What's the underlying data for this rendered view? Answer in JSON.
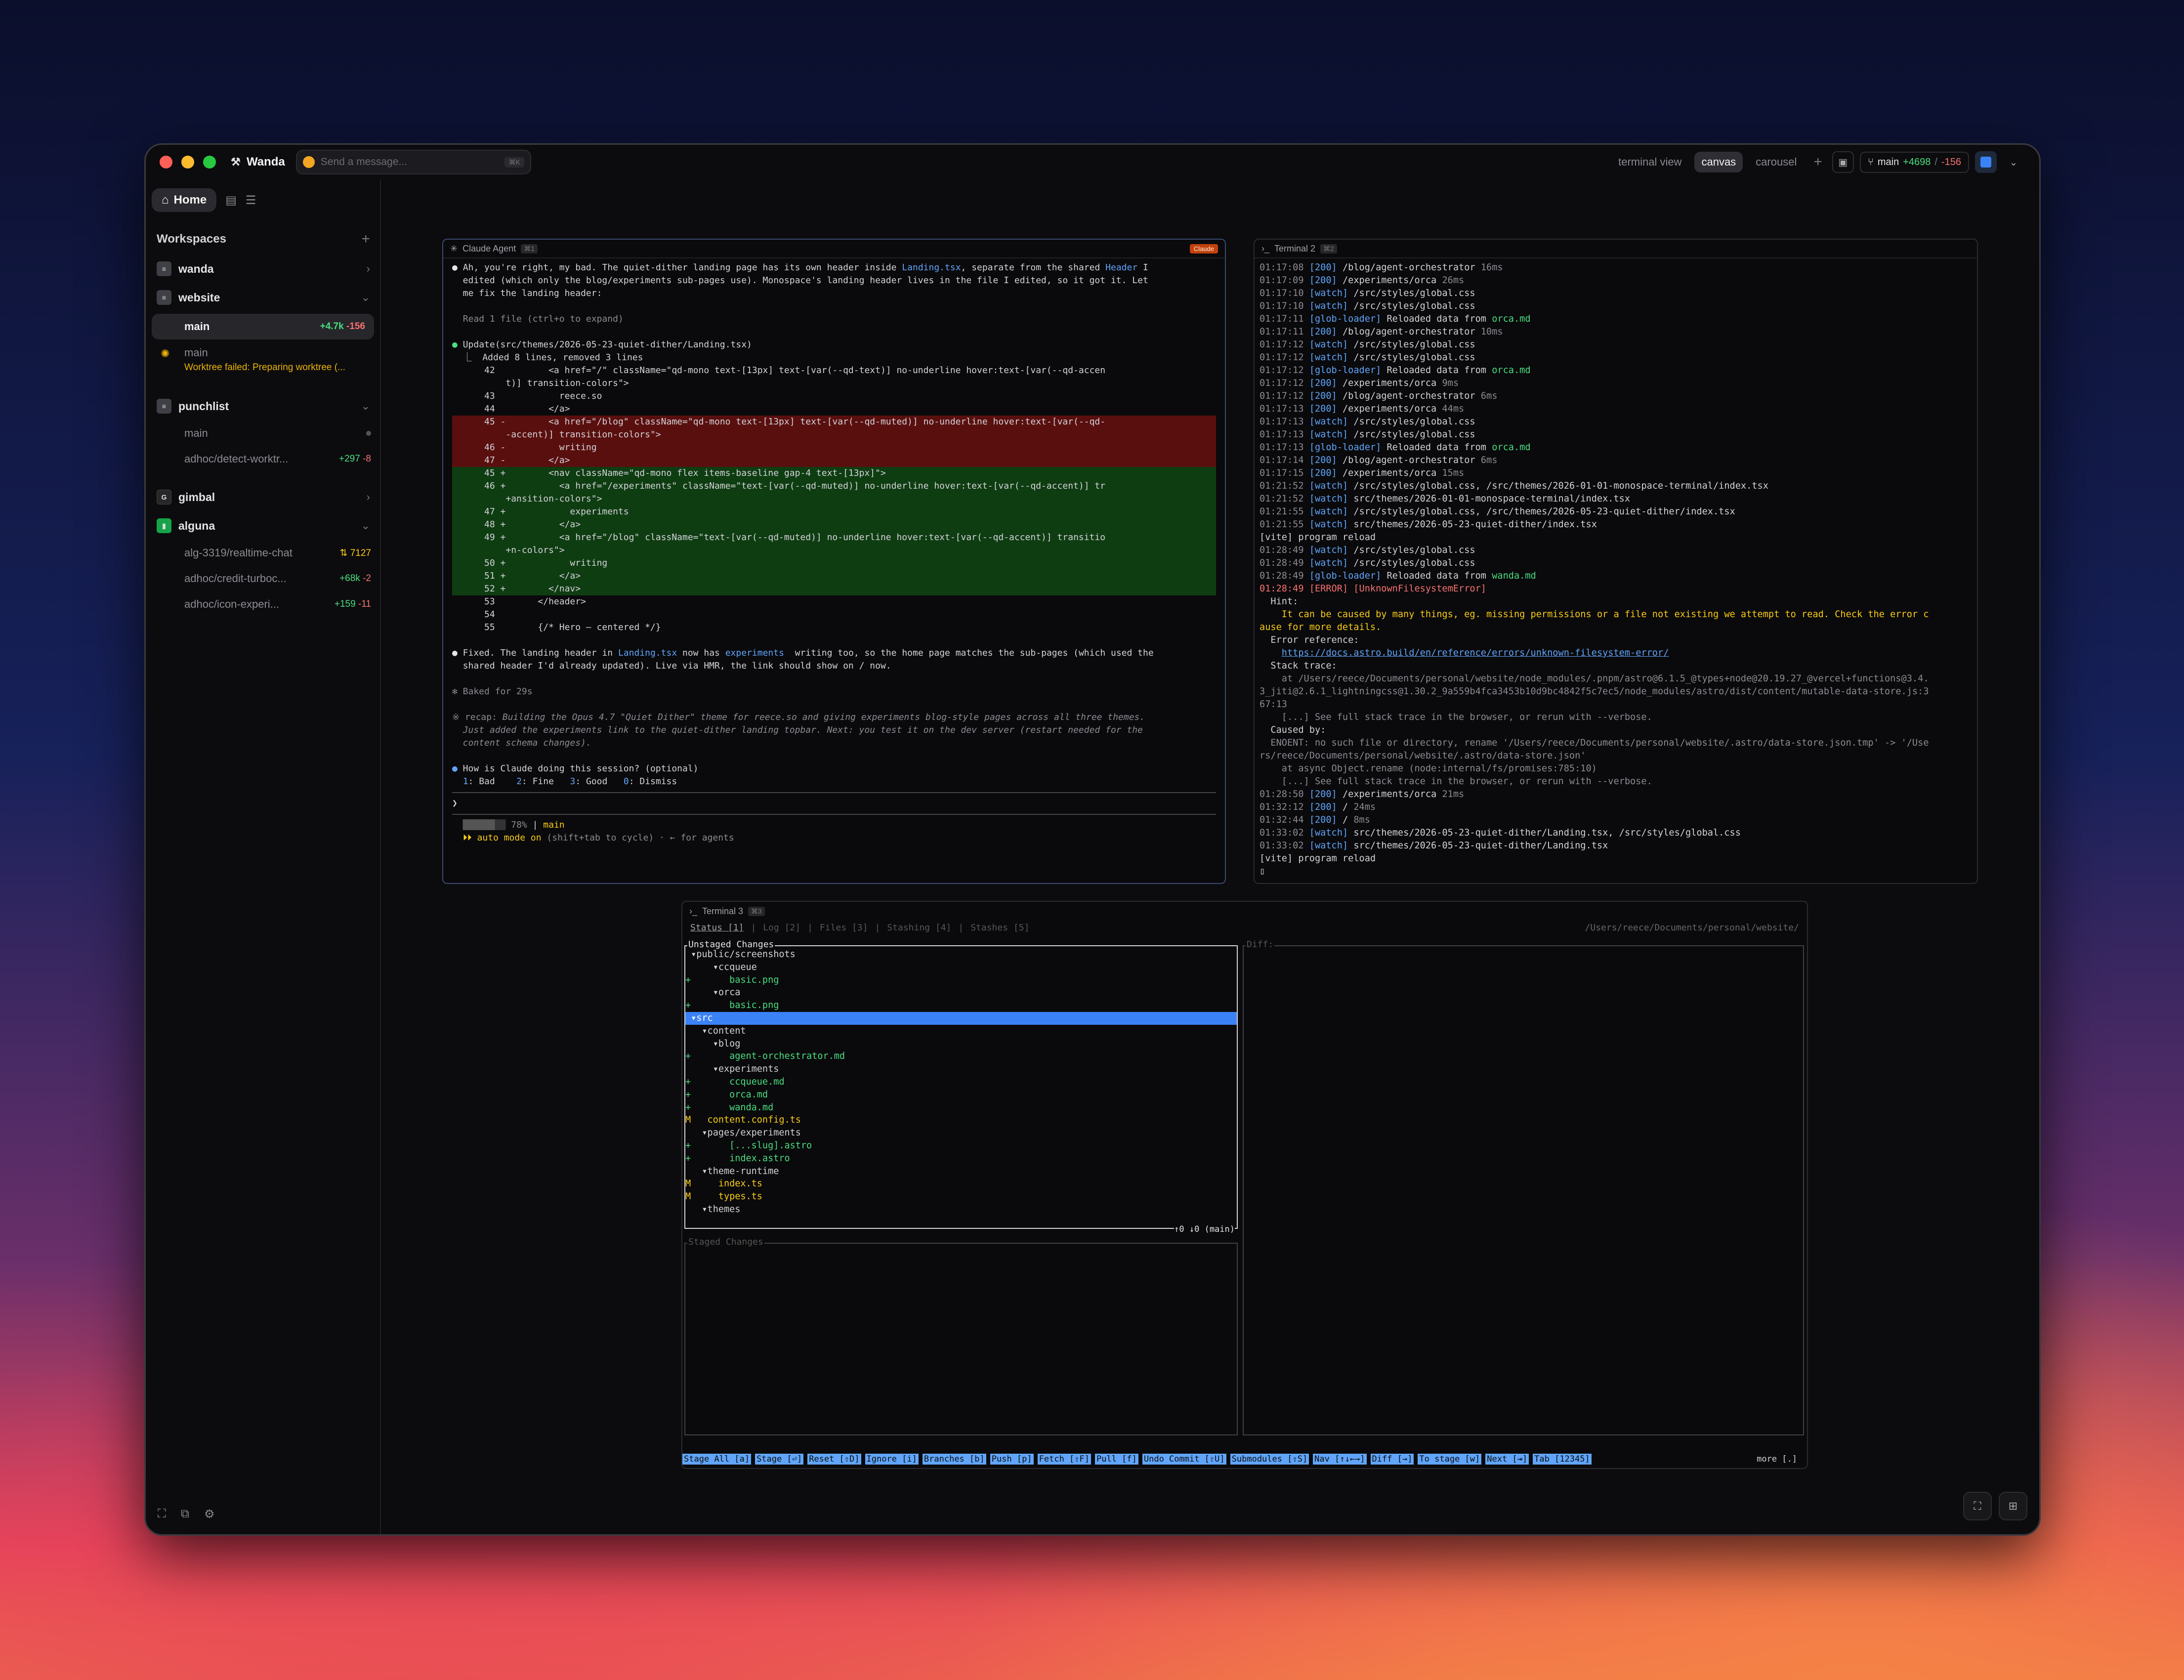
{
  "app": {
    "name": "Wanda",
    "message_placeholder": "Send a message...",
    "shortcut": "⌘K"
  },
  "views": [
    "terminal view",
    "canvas",
    "carousel"
  ],
  "active_view": "canvas",
  "branch": {
    "name": "main",
    "added": "+4698",
    "removed": "-156"
  },
  "sidebar": {
    "home": "Home",
    "workspaces_label": "Workspaces",
    "workspaces": [
      {
        "name": "wanda",
        "icon": "server-icon",
        "expanded": false,
        "worktrees": []
      },
      {
        "name": "website",
        "icon": "server-icon",
        "expanded": true,
        "worktrees": [
          {
            "name": "main",
            "added": "+4.7k",
            "removed": "-156",
            "selected": true
          },
          {
            "name": "main",
            "error": "Worktree failed: Preparing worktree (..."
          }
        ]
      },
      {
        "name": "punchlist",
        "icon": "server-icon",
        "expanded": true,
        "worktrees": [
          {
            "name": "main",
            "dot": true
          },
          {
            "name": "adhoc/detect-worktr...",
            "added": "+297",
            "removed": "-8"
          }
        ]
      },
      {
        "name": "gimbal",
        "icon": "G",
        "expanded": false,
        "worktrees": []
      },
      {
        "name": "alguna",
        "icon": "chart-icon",
        "expanded": true,
        "worktrees": [
          {
            "name": "alg-3319/realtime-chat",
            "pr": "7127"
          },
          {
            "name": "adhoc/credit-turboc...",
            "added": "+68k",
            "removed": "-2"
          },
          {
            "name": "adhoc/icon-experi...",
            "added": "+159",
            "removed": "-11"
          }
        ]
      }
    ]
  },
  "panels": {
    "claude": {
      "title": "Claude Agent",
      "num": "⌘1",
      "badge": "Claude"
    },
    "terminal2": {
      "title": "Terminal 2",
      "num": "⌘2"
    },
    "terminal3": {
      "title": "Terminal 3",
      "num": "⌘3"
    }
  },
  "lazygit": {
    "tabs": [
      "Status [1]",
      "Log [2]",
      "Files [3]",
      "Stashing [4]",
      "Stashes [5]"
    ],
    "path": "/Users/reece/Documents/personal/website/",
    "unstaged_title": "Unstaged Changes",
    "staged_title": "Staged Changes",
    "diff_title": "Diff:",
    "footer_status": "↑0 ↓0 (main)",
    "keys": [
      "Stage All [a]",
      "Stage [⏎]",
      "Reset [⇧D]",
      "Ignore [i]",
      "Branches [b]",
      "Push [p]",
      "Fetch [⇧F]",
      "Pull [f]",
      "Undo Commit [⇧U]",
      "Submodules [⇧S]",
      "Nav [↑↓←→]",
      "Diff [→]",
      "To stage [w]",
      "Next [⇥]",
      "Tab [12345]"
    ],
    "more": "more [.]"
  }
}
